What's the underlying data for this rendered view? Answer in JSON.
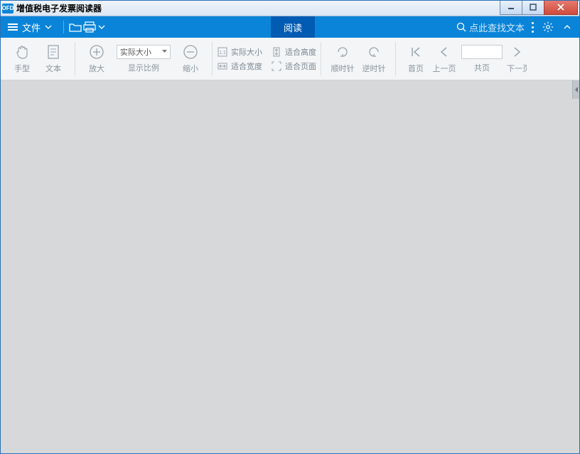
{
  "titlebar": {
    "app_icon_text": "OFD",
    "title": "增值税电子发票阅读器"
  },
  "menubar": {
    "file_label": "文件",
    "tab_read": "阅读",
    "search_placeholder": "点此查找文本"
  },
  "toolbar": {
    "hand": "手型",
    "text": "文本",
    "zoom_in": "放大",
    "zoom_select_value": "实际大小",
    "zoom_label": "显示比例",
    "zoom_out": "缩小",
    "fit_actual": "实际大小",
    "fit_height": "适合高度",
    "fit_width": "适合宽度",
    "fit_page": "适合页面",
    "rotate_cw": "顺时针",
    "rotate_ccw": "逆时针",
    "first_page": "首页",
    "prev_page": "上一页",
    "page_total_label": "共页",
    "next_page": "下一页"
  }
}
